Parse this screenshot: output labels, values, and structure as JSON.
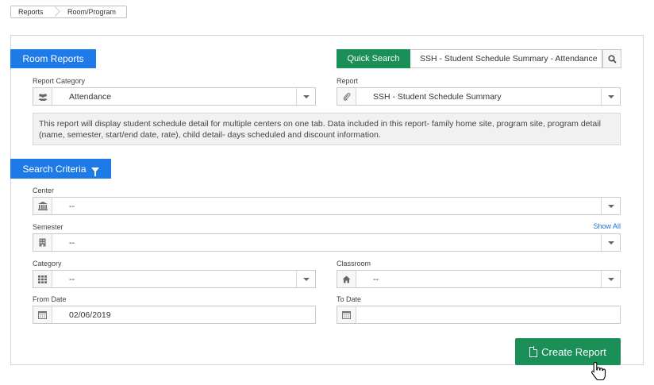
{
  "breadcrumb": {
    "items": [
      "Reports",
      "Room/Program"
    ]
  },
  "room_reports": {
    "title": "Room Reports"
  },
  "quick_search": {
    "button_label": "Quick Search",
    "value": "SSH - Student Schedule Summary - Attendance",
    "icon": "search-icon"
  },
  "report_category": {
    "label": "Report Category",
    "value": "Attendance",
    "icon": "users-icon"
  },
  "report": {
    "label": "Report",
    "value": "SSH - Student Schedule Summary",
    "icon": "paperclip-icon"
  },
  "description": "This report will display student schedule detail for multiple centers on one tab. Data included in this report- family home site, program site, program detail (name, semester, start/end date, rate), child detail- days scheduled and discount information.",
  "search_criteria": {
    "title": "Search Criteria",
    "icon": "filter-icon"
  },
  "center": {
    "label": "Center",
    "value": "--",
    "icon": "bank-icon"
  },
  "semester": {
    "label": "Semester",
    "value": "--",
    "icon": "building-icon",
    "show_all": "Show All"
  },
  "category": {
    "label": "Category",
    "value": "--",
    "icon": "grid-icon"
  },
  "classroom": {
    "label": "Classroom",
    "value": "--",
    "icon": "home-icon"
  },
  "from_date": {
    "label": "From Date",
    "value": "02/06/2019",
    "icon": "calendar-icon"
  },
  "to_date": {
    "label": "To Date",
    "value": "",
    "icon": "calendar-icon"
  },
  "create_report": {
    "label": "Create Report",
    "icon": "file-icon"
  },
  "colors": {
    "primary_blue": "#1e7ae6",
    "green": "#1a8f57",
    "link_blue": "#1e6fd9"
  }
}
